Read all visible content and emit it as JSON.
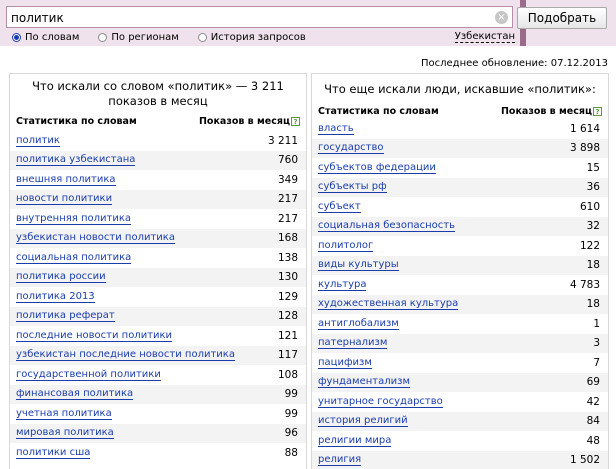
{
  "search": {
    "query": "политик",
    "button_label": "Подобрать",
    "clear_glyph": "×"
  },
  "modes": [
    {
      "label": "По словам",
      "checked": true
    },
    {
      "label": "По регионам",
      "checked": false
    },
    {
      "label": "История запросов",
      "checked": false
    }
  ],
  "region": "Узбекистан",
  "updated": "Последнее обновление: 07.12.2013",
  "left_panel": {
    "title": "Что искали со словом «политик» — 3 211 показов в месяц",
    "col_words": "Статистика по словам",
    "col_shows": "Показов в месяц",
    "rows": [
      {
        "word": "политик",
        "count": "3 211"
      },
      {
        "word": "политика узбекистана",
        "count": "760"
      },
      {
        "word": "внешняя политика",
        "count": "349"
      },
      {
        "word": "новости политики",
        "count": "217"
      },
      {
        "word": "внутренняя политика",
        "count": "217"
      },
      {
        "word": "узбекистан новости политика",
        "count": "168"
      },
      {
        "word": "социальная политика",
        "count": "138"
      },
      {
        "word": "политика россии",
        "count": "130"
      },
      {
        "word": "политика 2013",
        "count": "129"
      },
      {
        "word": "политика реферат",
        "count": "128"
      },
      {
        "word": "последние новости политики",
        "count": "121"
      },
      {
        "word": "узбекистан последние новости политика",
        "count": "117"
      },
      {
        "word": "государственной политики",
        "count": "108"
      },
      {
        "word": "финансовая политика",
        "count": "99"
      },
      {
        "word": "учетная политика",
        "count": "99"
      },
      {
        "word": "мировая политика",
        "count": "96"
      },
      {
        "word": "политики сша",
        "count": "88"
      }
    ]
  },
  "right_panel": {
    "title": "Что еще искали люди, искавшие «политик»:",
    "col_words": "Статистика по словам",
    "col_shows": "Показов в месяц",
    "rows": [
      {
        "word": "власть",
        "count": "1 614"
      },
      {
        "word": "государство",
        "count": "3 898"
      },
      {
        "word": "субъектов федерации",
        "count": "15"
      },
      {
        "word": "субъекты рф",
        "count": "36"
      },
      {
        "word": "субъект",
        "count": "610"
      },
      {
        "word": "социальная безопасность",
        "count": "32"
      },
      {
        "word": "политолог",
        "count": "122"
      },
      {
        "word": "виды культуры",
        "count": "18"
      },
      {
        "word": "культура",
        "count": "4 783"
      },
      {
        "word": "художественная культура",
        "count": "18"
      },
      {
        "word": "антиглобализм",
        "count": "1"
      },
      {
        "word": "патернализм",
        "count": "3"
      },
      {
        "word": "пацифизм",
        "count": "7"
      },
      {
        "word": "фундаментализм",
        "count": "69"
      },
      {
        "word": "унитарное государство",
        "count": "42"
      },
      {
        "word": "история религий",
        "count": "84"
      },
      {
        "word": "религии мира",
        "count": "48"
      },
      {
        "word": "религия",
        "count": "1 502"
      }
    ]
  },
  "colors": {
    "link": "#1a3dab",
    "header_bg": "#f0e2ec",
    "row_alt": "#f3f3f3"
  }
}
